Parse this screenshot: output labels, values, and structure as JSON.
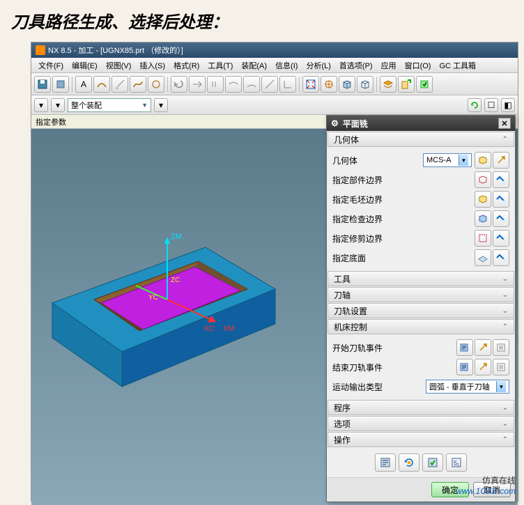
{
  "page_title": "刀具路径生成、选择后处理：",
  "app": {
    "title": "NX 8.5 - 加工 - [UGNX85.prt （修改的）]"
  },
  "menu": {
    "file": "文件(F)",
    "edit": "编辑(E)",
    "view": "视图(V)",
    "insert": "插入(S)",
    "format": "格式(R)",
    "tools": "工具(T)",
    "assembly": "装配(A)",
    "info": "信息(I)",
    "analysis": "分析(L)",
    "preferences": "首选项(P)",
    "application": "应用",
    "window": "窗口(O)",
    "gc": "GC 工具箱"
  },
  "toolbar2": {
    "assembly_combo": "整个装配"
  },
  "status": "指定参数",
  "dialog": {
    "title": "平面铣",
    "sections": {
      "geometry": "几何体",
      "tool": "工具",
      "axis": "刀轴",
      "path_settings": "刀轨设置",
      "machine_control": "机床控制",
      "program": "程序",
      "options": "选项",
      "operation": "操作"
    },
    "geometry": {
      "body_label": "几何体",
      "body_value": "MCS-A",
      "part_boundary": "指定部件边界",
      "blank_boundary": "指定毛坯边界",
      "check_boundary": "指定检查边界",
      "trim_boundary": "指定修剪边界",
      "floor": "指定底面"
    },
    "machine": {
      "start_event": "开始刀轨事件",
      "end_event": "结束刀轨事件",
      "motion_output_label": "运动输出类型",
      "motion_output_value": "圆弧 - 垂直于刀轴"
    },
    "buttons": {
      "ok": "确定",
      "cancel": "取消"
    }
  },
  "watermark": {
    "top": "仿真在线",
    "bottom": "www.1CAE.com"
  },
  "viewport_labels": {
    "zm": "ZM",
    "zc": "ZC",
    "yc": "YC",
    "xc": "XC",
    "xm": "XM"
  }
}
